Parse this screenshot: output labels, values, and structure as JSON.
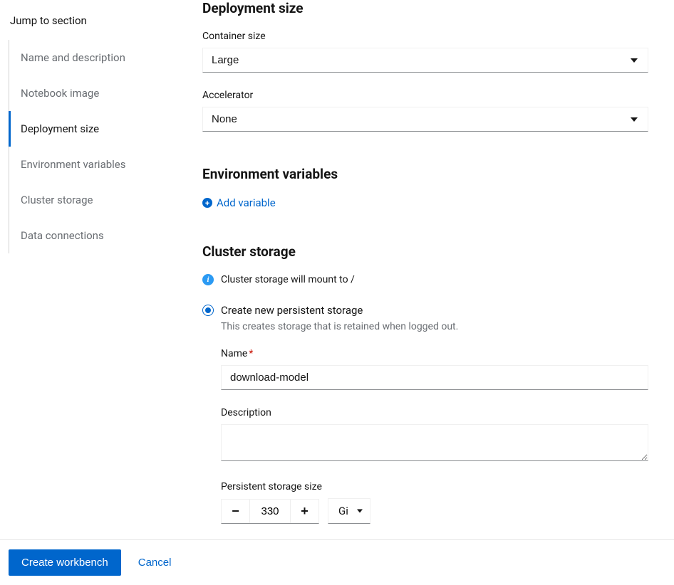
{
  "sidebar": {
    "title": "Jump to section",
    "items": [
      {
        "label": "Name and description"
      },
      {
        "label": "Notebook image"
      },
      {
        "label": "Deployment size"
      },
      {
        "label": "Environment variables"
      },
      {
        "label": "Cluster storage"
      },
      {
        "label": "Data connections"
      }
    ]
  },
  "deployment": {
    "heading": "Deployment size",
    "container_label": "Container size",
    "container_value": "Large",
    "accelerator_label": "Accelerator",
    "accelerator_value": "None"
  },
  "env": {
    "heading": "Environment variables",
    "add_label": "Add variable"
  },
  "storage": {
    "heading": "Cluster storage",
    "info_text": "Cluster storage will mount to /",
    "radio_label": "Create new persistent storage",
    "radio_help": "This creates storage that is retained when logged out.",
    "name_label": "Name",
    "name_value": "download-model",
    "desc_label": "Description",
    "desc_value": "",
    "size_label": "Persistent storage size",
    "size_value": "330",
    "size_unit": "Gi"
  },
  "footer": {
    "create_label": "Create workbench",
    "cancel_label": "Cancel"
  }
}
